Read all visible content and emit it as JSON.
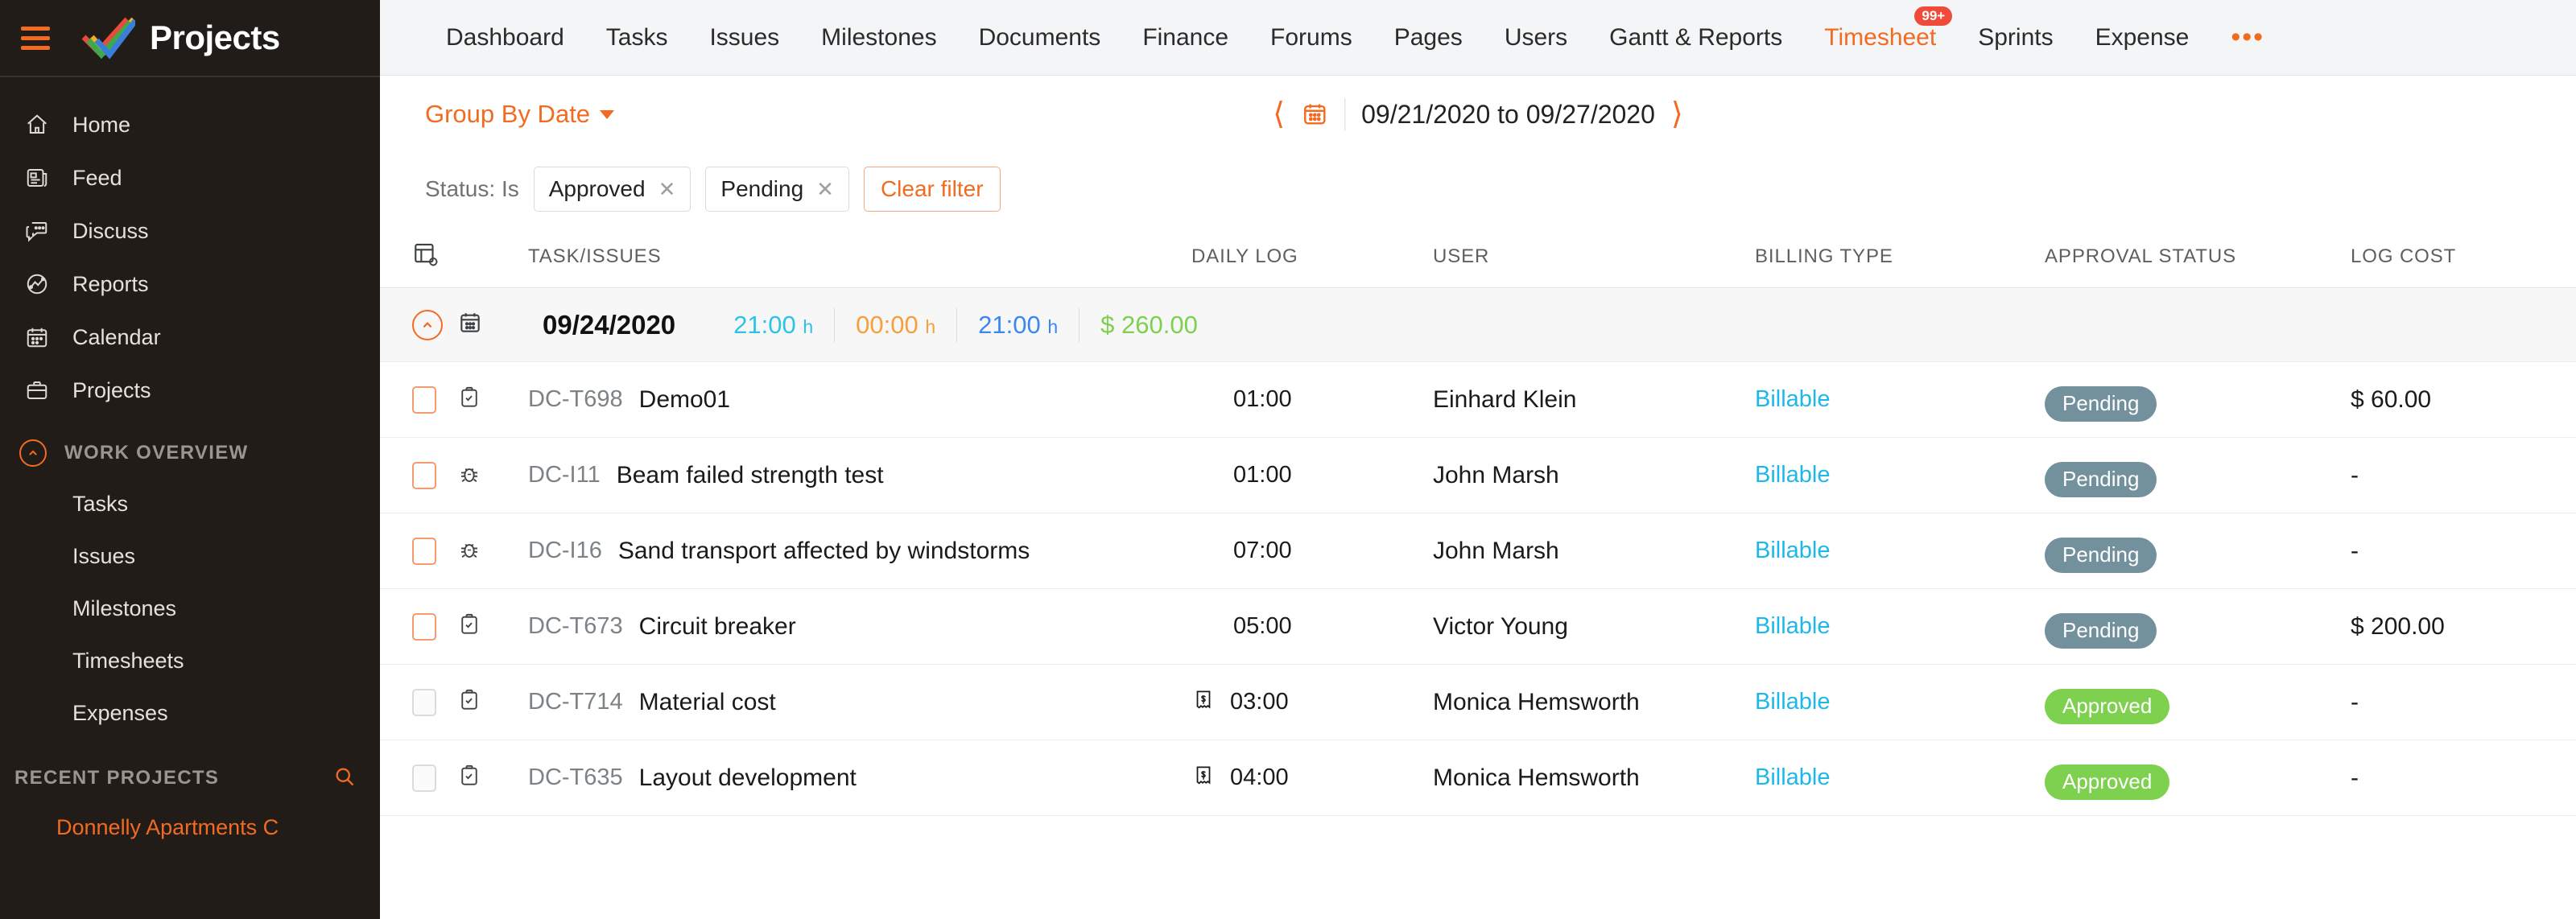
{
  "sidebar": {
    "brand": {
      "title": "Projects",
      "logo_icon": "zoho-projects-logo",
      "menu_icon": "hamburger-menu-icon"
    },
    "items": [
      {
        "label": "Home",
        "icon": "home-icon"
      },
      {
        "label": "Feed",
        "icon": "feed-icon"
      },
      {
        "label": "Discuss",
        "icon": "discuss-chat-icon"
      },
      {
        "label": "Reports",
        "icon": "reports-chart-icon"
      },
      {
        "label": "Calendar",
        "icon": "calendar-icon"
      },
      {
        "label": "Projects",
        "icon": "briefcase-icon"
      }
    ],
    "work_overview": {
      "label": "WORK OVERVIEW",
      "collapse_icon": "chevron-up-circle-icon",
      "items": [
        "Tasks",
        "Issues",
        "Milestones",
        "Timesheets",
        "Expenses"
      ]
    },
    "recent_projects": {
      "label": "RECENT PROJECTS",
      "search_icon": "search-icon",
      "items": [
        "Donnelly Apartments C"
      ]
    }
  },
  "topnav": {
    "items": [
      {
        "label": "Dashboard",
        "active": false
      },
      {
        "label": "Tasks",
        "active": false
      },
      {
        "label": "Issues",
        "active": false
      },
      {
        "label": "Milestones",
        "active": false
      },
      {
        "label": "Documents",
        "active": false
      },
      {
        "label": "Finance",
        "active": false
      },
      {
        "label": "Forums",
        "active": false
      },
      {
        "label": "Pages",
        "active": false
      },
      {
        "label": "Users",
        "active": false
      },
      {
        "label": "Gantt & Reports",
        "active": false
      },
      {
        "label": "Timesheet",
        "active": true,
        "badge": "99+"
      },
      {
        "label": "Sprints",
        "active": false
      },
      {
        "label": "Expense",
        "active": false
      }
    ],
    "more_icon": "ellipsis-icon"
  },
  "toolbar": {
    "group_by": "Group By Date",
    "group_by_caret_icon": "chevron-down-icon",
    "prev_icon": "chevron-left-icon",
    "next_icon": "chevron-right-icon",
    "calendar_icon": "calendar-icon",
    "date_range": "09/21/2020 to 09/27/2020"
  },
  "filter": {
    "label": "Status: Is",
    "chips": [
      {
        "label": "Approved",
        "remove_icon": "close-icon"
      },
      {
        "label": "Pending",
        "remove_icon": "close-icon"
      }
    ],
    "clear_label": "Clear filter"
  },
  "table": {
    "settings_icon": "table-column-settings-icon",
    "columns": [
      "TASK/ISSUES",
      "DAILY LOG",
      "USER",
      "BILLING TYPE",
      "APPROVAL STATUS",
      "LOG COST"
    ],
    "group": {
      "collapse_icon": "chevron-up-circle-icon",
      "date_icon": "calendar-icon",
      "date": "09/24/2020",
      "stats": [
        {
          "value": "21:00",
          "unit": "h",
          "color": "#2bc4e8"
        },
        {
          "value": "00:00",
          "unit": "h",
          "color": "#f5a03c"
        },
        {
          "value": "21:00",
          "unit": "h",
          "color": "#3b86f5"
        },
        {
          "value": "$ 260.00",
          "unit": "",
          "color": "#7ed04f"
        }
      ]
    },
    "rows": [
      {
        "checkbox_state": "orange",
        "type_icon": "task-clipboard-icon",
        "id": "DC-T698",
        "name": "Demo01",
        "invoice_icon": "",
        "daily_log": "01:00",
        "user": "Einhard Klein",
        "billing_type": "Billable",
        "approval_status": "Pending",
        "approval_color": "#73909d",
        "log_cost": "$ 60.00"
      },
      {
        "checkbox_state": "orange",
        "type_icon": "bug-issue-icon",
        "id": "DC-I11",
        "name": "Beam failed strength test",
        "invoice_icon": "",
        "daily_log": "01:00",
        "user": "John Marsh",
        "billing_type": "Billable",
        "approval_status": "Pending",
        "approval_color": "#73909d",
        "log_cost": "-"
      },
      {
        "checkbox_state": "orange",
        "type_icon": "bug-issue-icon",
        "id": "DC-I16",
        "name": "Sand transport affected by windstorms",
        "invoice_icon": "",
        "daily_log": "07:00",
        "user": "John Marsh",
        "billing_type": "Billable",
        "approval_status": "Pending",
        "approval_color": "#73909d",
        "log_cost": "-"
      },
      {
        "checkbox_state": "orange",
        "type_icon": "task-clipboard-icon",
        "id": "DC-T673",
        "name": "Circuit breaker",
        "invoice_icon": "",
        "daily_log": "05:00",
        "user": "Victor Young",
        "billing_type": "Billable",
        "approval_status": "Pending",
        "approval_color": "#73909d",
        "log_cost": "$ 200.00"
      },
      {
        "checkbox_state": "gray",
        "type_icon": "task-clipboard-icon",
        "id": "DC-T714",
        "name": "Material cost",
        "invoice_icon": "invoice-receipt-icon",
        "daily_log": "03:00",
        "user": "Monica Hemsworth",
        "billing_type": "Billable",
        "approval_status": "Approved",
        "approval_color": "#7ed04f",
        "log_cost": "-"
      },
      {
        "checkbox_state": "gray",
        "type_icon": "task-clipboard-icon",
        "id": "DC-T635",
        "name": "Layout development",
        "invoice_icon": "invoice-receipt-icon",
        "daily_log": "04:00",
        "user": "Monica Hemsworth",
        "billing_type": "Billable",
        "approval_status": "Approved",
        "approval_color": "#7ed04f",
        "log_cost": "-"
      }
    ]
  },
  "colors": {
    "accent": "#f26b21",
    "sidebar_bg": "#221c18",
    "badge_red": "#ee4b3a",
    "link_blue": "#1db8e8",
    "approved_green": "#7ed04f",
    "pending_slate": "#73909d"
  }
}
